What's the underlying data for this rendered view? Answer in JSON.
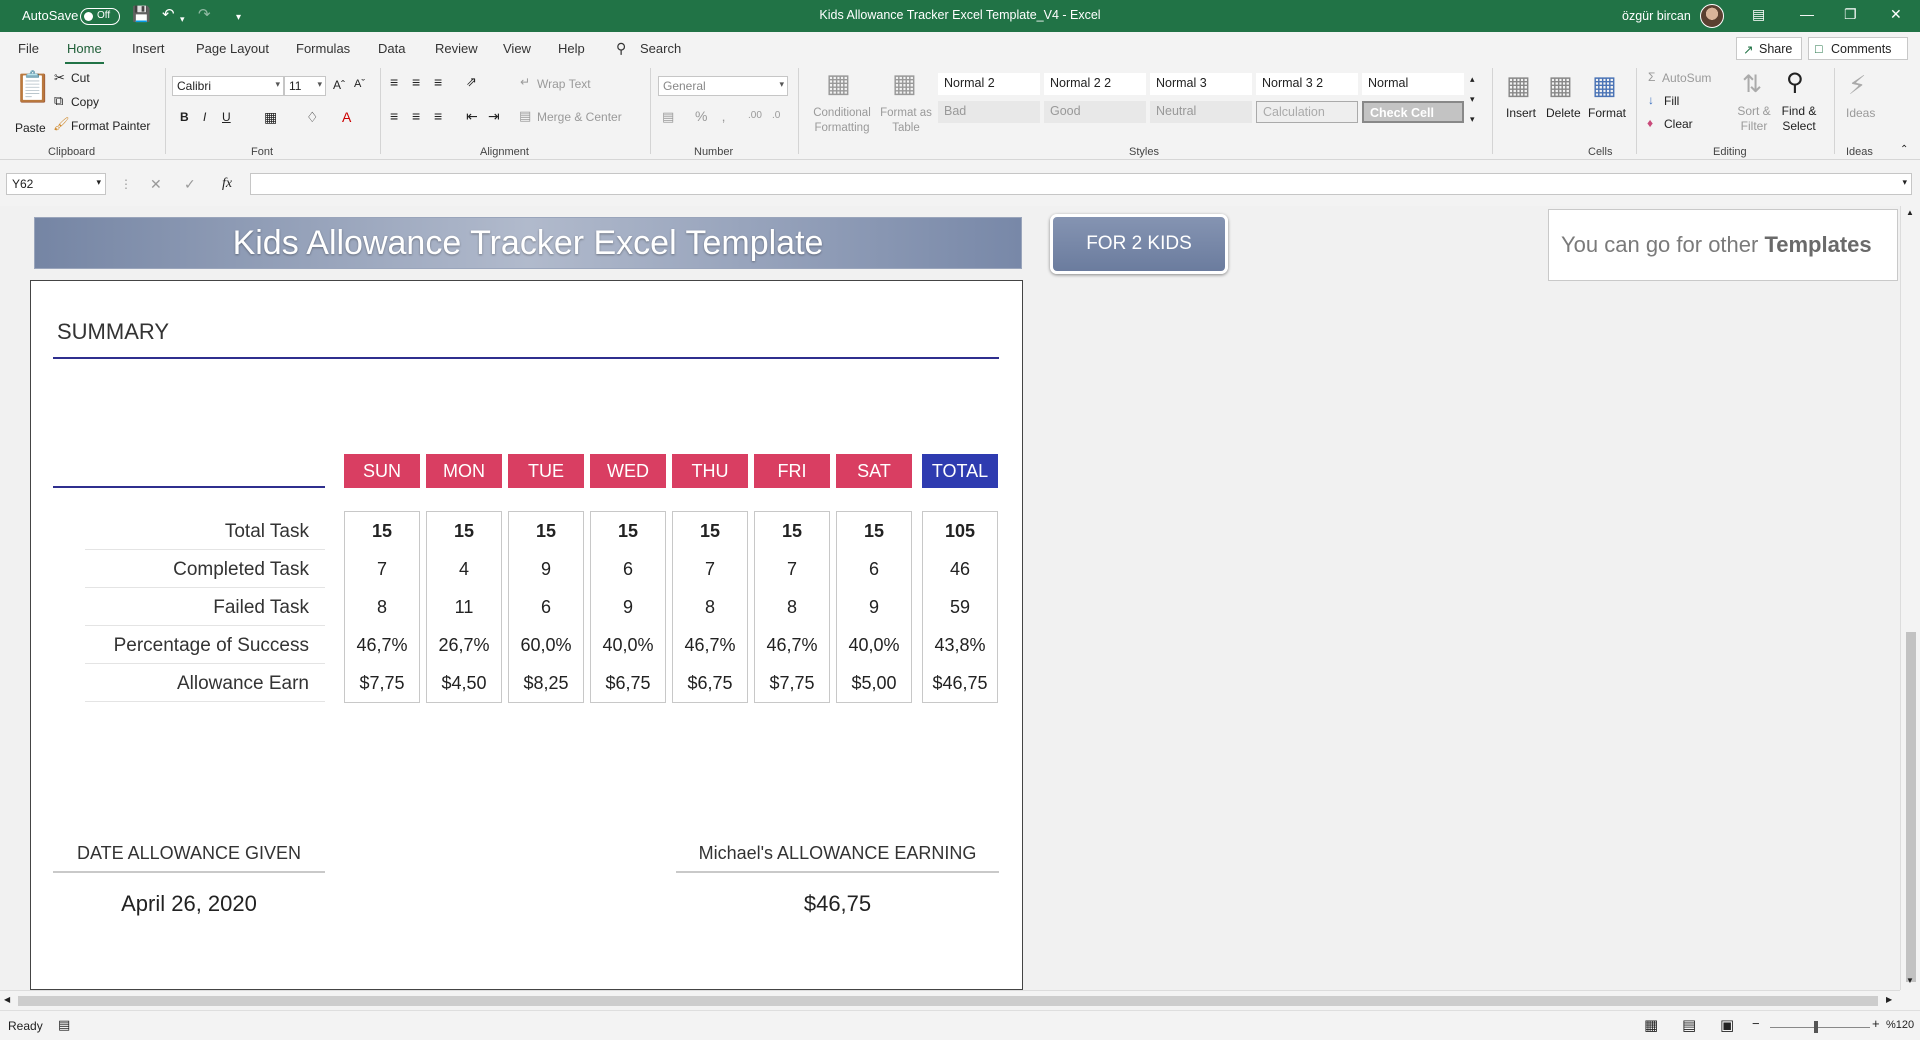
{
  "titlebar": {
    "autosave_label": "AutoSave",
    "autosave_state": "Off",
    "document_title": "Kids Allowance Tracker Excel Template_V4  -  Excel",
    "user_name": "özgür bircan"
  },
  "ribbon_tabs": [
    "File",
    "Home",
    "Insert",
    "Page Layout",
    "Formulas",
    "Data",
    "Review",
    "View",
    "Help"
  ],
  "active_tab": "Home",
  "search_label": "Search",
  "share_label": "Share",
  "comments_label": "Comments",
  "clipboard": {
    "paste": "Paste",
    "cut": "Cut",
    "copy": "Copy",
    "format_painter": "Format Painter",
    "group": "Clipboard"
  },
  "font": {
    "name": "Calibri",
    "size": "11",
    "group": "Font"
  },
  "alignment": {
    "wrap_text": "Wrap Text",
    "merge_center": "Merge & Center",
    "group": "Alignment"
  },
  "number": {
    "format": "General",
    "group": "Number"
  },
  "styles": {
    "conditional_formatting": "Conditional Formatting",
    "format_as_table": "Format as Table",
    "gallery_row1": [
      "Normal 2",
      "Normal 2 2",
      "Normal 3",
      "Normal 3 2",
      "Normal"
    ],
    "gallery_row2": [
      "Bad",
      "Good",
      "Neutral",
      "Calculation",
      "Check Cell"
    ],
    "group": "Styles"
  },
  "cells": {
    "insert": "Insert",
    "delete": "Delete",
    "format": "Format",
    "group": "Cells"
  },
  "editing": {
    "autosum": "AutoSum",
    "fill": "Fill",
    "clear": "Clear",
    "sort_filter": "Sort & Filter",
    "find_select": "Find & Select",
    "group": "Editing"
  },
  "ideas": {
    "label": "Ideas",
    "group": "Ideas"
  },
  "formula_bar": {
    "name_box": "Y62",
    "fx": "fx",
    "value": ""
  },
  "sheet": {
    "banner_title": "Kids Allowance Tracker Excel Template",
    "kids_button": "FOR 2 KIDS",
    "templates_text_prefix": "You can go for other ",
    "templates_text_bold": "Templates",
    "summary_title": "SUMMARY",
    "days": [
      "SUN",
      "MON",
      "TUE",
      "WED",
      "THU",
      "FRI",
      "SAT",
      "TOTAL"
    ],
    "row_labels": [
      "Total Task",
      "Completed Task",
      "Failed Task",
      "Percentage of Success",
      "Allowance Earn"
    ],
    "table": [
      [
        "15",
        "7",
        "8",
        "46,7%",
        "$7,75"
      ],
      [
        "15",
        "4",
        "11",
        "26,7%",
        "$4,50"
      ],
      [
        "15",
        "9",
        "6",
        "60,0%",
        "$8,25"
      ],
      [
        "15",
        "6",
        "9",
        "40,0%",
        "$6,75"
      ],
      [
        "15",
        "7",
        "8",
        "46,7%",
        "$6,75"
      ],
      [
        "15",
        "7",
        "8",
        "46,7%",
        "$7,75"
      ],
      [
        "15",
        "6",
        "9",
        "40,0%",
        "$5,00"
      ],
      [
        "105",
        "46",
        "59",
        "43,8%",
        "$46,75"
      ]
    ],
    "date_label": "DATE ALLOWANCE GIVEN",
    "date_value": "April 26, 2020",
    "earning_label": "Michael's ALLOWANCE EARNING",
    "earning_value": "$46,75"
  },
  "status": {
    "ready": "Ready",
    "zoom": "%120"
  },
  "colors": {
    "excel_green": "#217346",
    "day_header": "#d93e62",
    "total_header": "#2e3bb0",
    "rule_blue": "#2f2f8e"
  }
}
